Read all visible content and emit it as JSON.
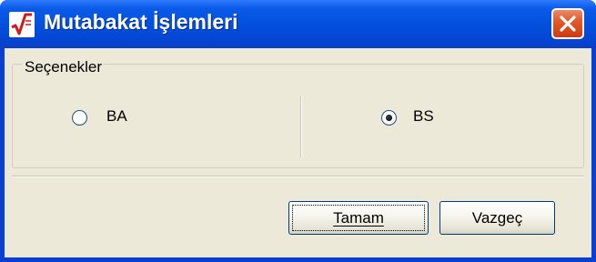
{
  "window": {
    "title": "Mutabakat İşlemleri",
    "close_label": "Close"
  },
  "options_group": {
    "legend": "Seçenekler",
    "options": [
      {
        "label": "BA",
        "selected": false
      },
      {
        "label": "BS",
        "selected": true
      }
    ]
  },
  "buttons": {
    "ok_label": "Tamam",
    "cancel_label": "Vazgeç"
  },
  "colors": {
    "titlebar": "#0350de",
    "client_bg": "#ece9d8",
    "close_button": "#e25a2a"
  },
  "icons": {
    "app": "square-root-icon",
    "close": "close-icon"
  }
}
